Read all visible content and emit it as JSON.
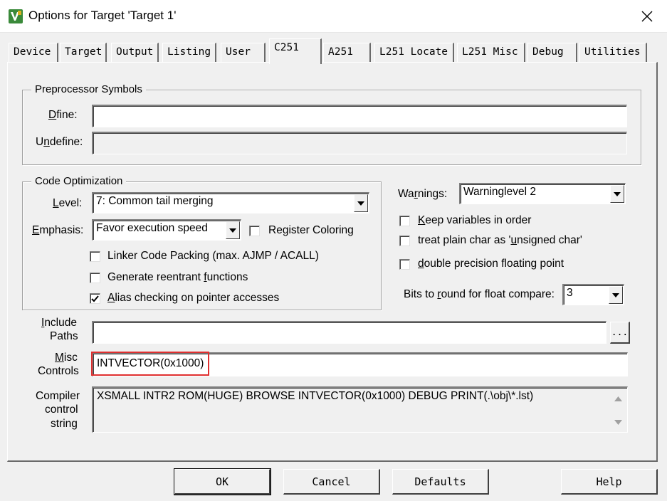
{
  "window": {
    "title": "Options for Target 'Target 1'",
    "icons": {
      "app": "keil-uvision-icon",
      "close": "close-icon"
    }
  },
  "tabs": [
    {
      "label": "Device"
    },
    {
      "label": "Target"
    },
    {
      "label": "Output"
    },
    {
      "label": "Listing"
    },
    {
      "label": "User"
    },
    {
      "label": "C251",
      "active": true
    },
    {
      "label": "A251"
    },
    {
      "label": "L251 Locate"
    },
    {
      "label": "L251 Misc"
    },
    {
      "label": "Debug"
    },
    {
      "label": "Utilities"
    }
  ],
  "preprocessor": {
    "legend": "Preprocessor Symbols",
    "define_pre": "D",
    "define_u": "e",
    "define_post": "fine:",
    "define_value": "",
    "undefine_pre": "U",
    "undefine_u": "n",
    "undefine_post": "define:",
    "undefine_value": ""
  },
  "optimization": {
    "legend": "Code Optimization",
    "level_u": "L",
    "level_post": "evel:",
    "level_value": "7: Common tail merging",
    "emphasis_u": "E",
    "emphasis_post": "mphasis:",
    "emphasis_value": "Favor execution speed",
    "register_coloring_pre": "Re",
    "register_coloring_u": "g",
    "register_coloring_post": "ister Coloring",
    "register_coloring_checked": false,
    "linker_packing": "Linker Code Packing (max. AJMP / ACALL)",
    "linker_packing_checked": false,
    "reentrant_pre": "Generate reentrant ",
    "reentrant_u": "f",
    "reentrant_post": "unctions",
    "reentrant_checked": false,
    "alias_u": "A",
    "alias_post": "lias checking on pointer accesses",
    "alias_checked": true
  },
  "warnings": {
    "label_pre": "Wa",
    "label_u": "r",
    "label_post": "nings:",
    "value": "Warninglevel 2",
    "keep_vars_u": "K",
    "keep_vars_post": "eep variables in order",
    "keep_vars_checked": false,
    "plain_char_pre": "treat plain char as '",
    "plain_char_u": "u",
    "plain_char_post": "nsigned char'",
    "plain_char_checked": false,
    "double_u": "d",
    "double_post": "ouble precision floating point",
    "double_checked": false,
    "bits_pre": "Bits to ",
    "bits_u": "r",
    "bits_post": "ound for float compare:",
    "bits_value": "3"
  },
  "include": {
    "label_line1_u": "I",
    "label_line1_post": "nclude",
    "label_line2": "Paths",
    "value": "",
    "browse": "..."
  },
  "misc": {
    "label_line1_u": "M",
    "label_line1_post": "isc",
    "label_line2": "Controls",
    "value": "INTVECTOR(0x1000)"
  },
  "compiler": {
    "label_line1": "Compiler",
    "label_line2": "control",
    "label_line3": "string",
    "value": "XSMALL INTR2 ROM(HUGE) BROWSE INTVECTOR(0x1000) DEBUG PRINT(.\\obj\\*.lst)"
  },
  "buttons": {
    "ok": "OK",
    "cancel": "Cancel",
    "defaults": "Defaults",
    "help": "Help"
  },
  "colors": {
    "highlight": "#e03030",
    "app_icon": "#3a8a3a"
  }
}
